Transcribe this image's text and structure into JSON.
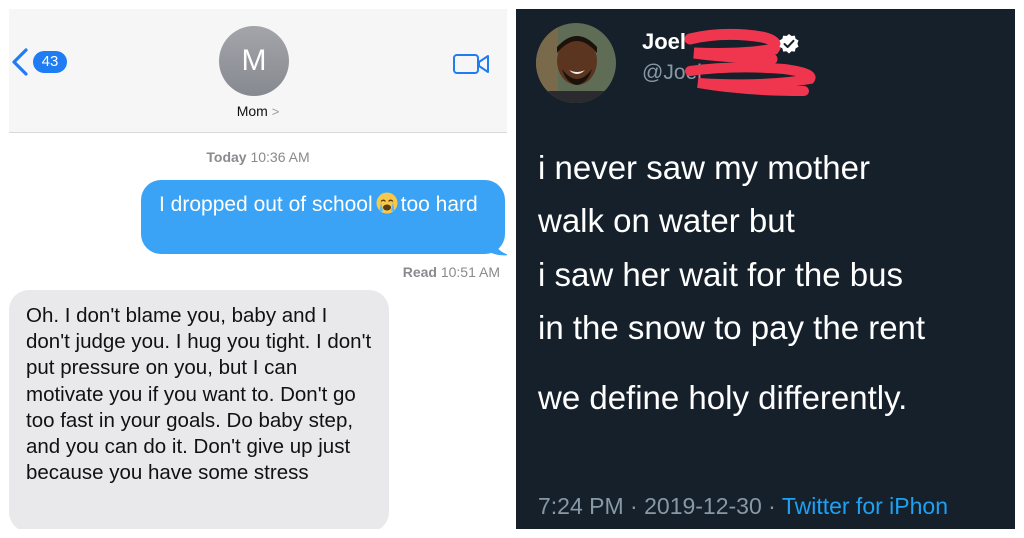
{
  "imessage": {
    "back_count": "43",
    "avatar_initial": "M",
    "contact_name": "Mom",
    "contact_chevron": ">",
    "timestamp_day": "Today",
    "timestamp_time": "10:36 AM",
    "sent_text_part1": "I dropped out of school",
    "sent_emoji": "crying-face-emoji",
    "sent_text_part2": "too hard",
    "read_label": "Read",
    "read_time": "10:51 AM",
    "received_text": "Oh. I don't blame you, baby and I don't judge you. I hug you tight. I don't put pressure on you, but I can motivate you if you want to. Don't go too fast in your goals. Do baby step, and you can do it. Don't give up just because you have some stress",
    "colors": {
      "sent_bubble": "#3aa3f5",
      "received_bubble": "#e9e9eb",
      "accent": "#1f7cf2"
    }
  },
  "tweet": {
    "name": "Joel",
    "handle": "@Joel",
    "lines": [
      "i never saw my mother",
      "walk on water but",
      "i saw her wait for the bus",
      "in the snow to pay the rent",
      "we define holy differently."
    ],
    "time": "7:24 PM",
    "date": "2019-12-30",
    "separator": "·",
    "source": "Twitter for iPhon",
    "colors": {
      "background": "#15202b",
      "text": "#ffffff",
      "muted": "#8899a6",
      "link": "#1da1f2",
      "redaction": "#f0364f"
    }
  }
}
